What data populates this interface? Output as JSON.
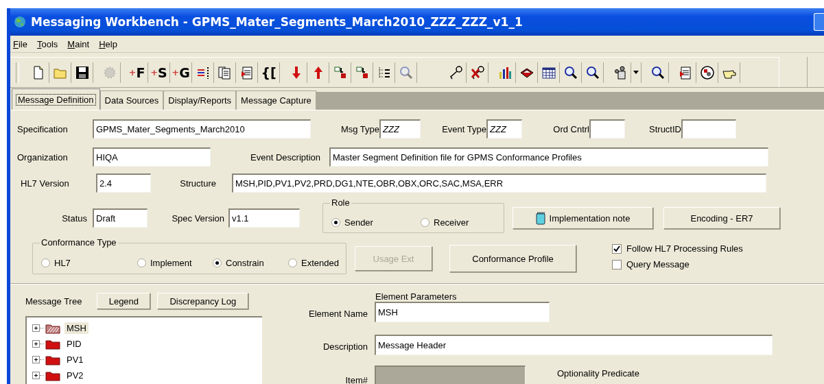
{
  "window": {
    "title": "Messaging Workbench - GPMS_Mater_Segments_March2010_ZZZ_ZZZ_v1_1"
  },
  "menu": [
    "File",
    "Tools",
    "Maint",
    "Help"
  ],
  "toolbar_labels": [
    "+F",
    "+S",
    "+G",
    "{["
  ],
  "tabs": [
    {
      "label": "Message Definition",
      "selected": true
    },
    {
      "label": "Data Sources",
      "selected": false
    },
    {
      "label": "Display/Reports",
      "selected": false
    },
    {
      "label": "Message Capture",
      "selected": false
    }
  ],
  "specification": {
    "label": "Specification",
    "value": "GPMS_Mater_Segments_March2010"
  },
  "msg_type": {
    "label": "Msg Type",
    "value": "ZZZ"
  },
  "event_type": {
    "label": "Event Type",
    "value": "ZZZ"
  },
  "ord_cntrl": {
    "label": "Ord Cntrl"
  },
  "struct_id": {
    "label": "StructID"
  },
  "organization": {
    "label": "Organization",
    "value": "HIQA"
  },
  "event_description": {
    "label": "Event Description",
    "value": "Master Segment Definition file for GPMS Conformance Profiles"
  },
  "hl7_version": {
    "label": "HL7 Version",
    "value": "2.4"
  },
  "structure": {
    "label": "Structure",
    "value": "MSH,PID,PV1,PV2,PRD,DG1,NTE,OBR,OBX,ORC,SAC,MSA,ERR"
  },
  "status": {
    "label": "Status",
    "value": "Draft"
  },
  "spec_version": {
    "label": "Spec Version",
    "value": "v1.1"
  },
  "role": {
    "title": "Role",
    "options": [
      {
        "label": "Sender",
        "selected": true
      },
      {
        "label": "Receiver",
        "selected": false
      }
    ]
  },
  "implementation_note_button": {
    "label": "Implementation note"
  },
  "encoding_button": {
    "label": "Encoding - ER7"
  },
  "conformance_type": {
    "title": "Conformance Type",
    "options": [
      {
        "label": "HL7",
        "selected": false
      },
      {
        "label": "Implement",
        "selected": false
      },
      {
        "label": "Constrain",
        "selected": true
      },
      {
        "label": "Extended",
        "selected": false
      }
    ]
  },
  "usage_ext_button": {
    "label": "Usage Ext",
    "disabled": true
  },
  "conformance_profile_button": {
    "label": "Conformance Profile",
    "disabled": false
  },
  "checkboxes": [
    {
      "label": "Follow HL7 Processing Rules",
      "checked": true
    },
    {
      "label": "Query Message",
      "checked": false
    }
  ],
  "message_tree": {
    "label": "Message Tree",
    "buttons": [
      "Legend",
      "Discrepancy Log"
    ],
    "items": [
      {
        "label": "MSH",
        "expanded": false,
        "selected": true
      },
      {
        "label": "PID",
        "expanded": false,
        "selected": false
      },
      {
        "label": "PV1",
        "expanded": false,
        "selected": false
      },
      {
        "label": "PV2",
        "expanded": false,
        "selected": false
      }
    ]
  },
  "element_parameters": {
    "title": "Element Parameters",
    "element_name": {
      "label": "Element Name",
      "value": "MSH"
    },
    "description": {
      "label": "Description",
      "value": "Message Header"
    },
    "item_number": {
      "label": "Item#",
      "disabled": true
    },
    "optionality_predicate": {
      "label": "Optionality Predicate"
    }
  }
}
